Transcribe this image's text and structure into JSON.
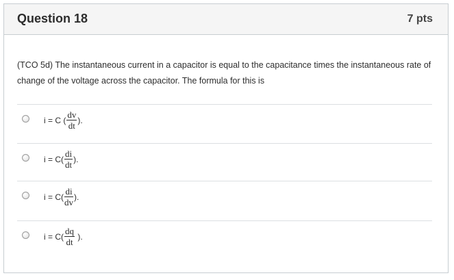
{
  "question": {
    "title": "Question 18",
    "points": "7 pts",
    "text": "(TCO 5d) The instantaneous current in a capacitor is equal to the capacitance times the instantaneous rate of change of the voltage across the capacitor. The formula for this is"
  },
  "answers": [
    {
      "pre": "i = C (",
      "num": "dv",
      "den": "dt",
      "post": ")."
    },
    {
      "pre": "i = C(",
      "num": "di",
      "den": "dt",
      "post": ")."
    },
    {
      "pre": "i = C(",
      "num": "di",
      "den": "dv",
      "post": ")."
    },
    {
      "pre": "i = C(",
      "num": "dq",
      "den": "dt",
      "post": " )."
    }
  ]
}
